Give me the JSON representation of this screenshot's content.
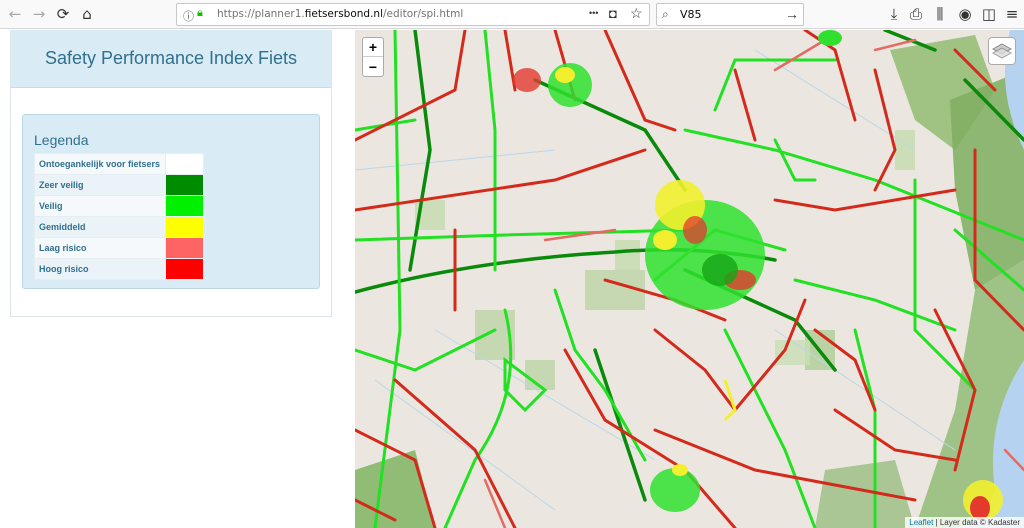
{
  "browser": {
    "url_prefix": "https://planner1.",
    "url_domain": "fietsersbond.nl",
    "url_path": "/editor/spi.html",
    "search_value": "V85",
    "menu_dots": "•••"
  },
  "panel": {
    "title": "Safety Performance Index Fiets"
  },
  "legend": {
    "title": "Legenda",
    "items": [
      {
        "label": "Ontoegankelijk voor fietsers",
        "color": "#ffffff"
      },
      {
        "label": "Zeer veilig",
        "color": "#008c00"
      },
      {
        "label": "Veilig",
        "color": "#00f000"
      },
      {
        "label": "Gemiddeld",
        "color": "#ffff00"
      },
      {
        "label": "Laag risico",
        "color": "#ff6464"
      },
      {
        "label": "Hoog risico",
        "color": "#ff0000"
      }
    ]
  },
  "map": {
    "zoom_in": "+",
    "zoom_out": "−",
    "attribution_link": "Leaflet",
    "attribution_text": " | Layer data © Kadaster"
  }
}
